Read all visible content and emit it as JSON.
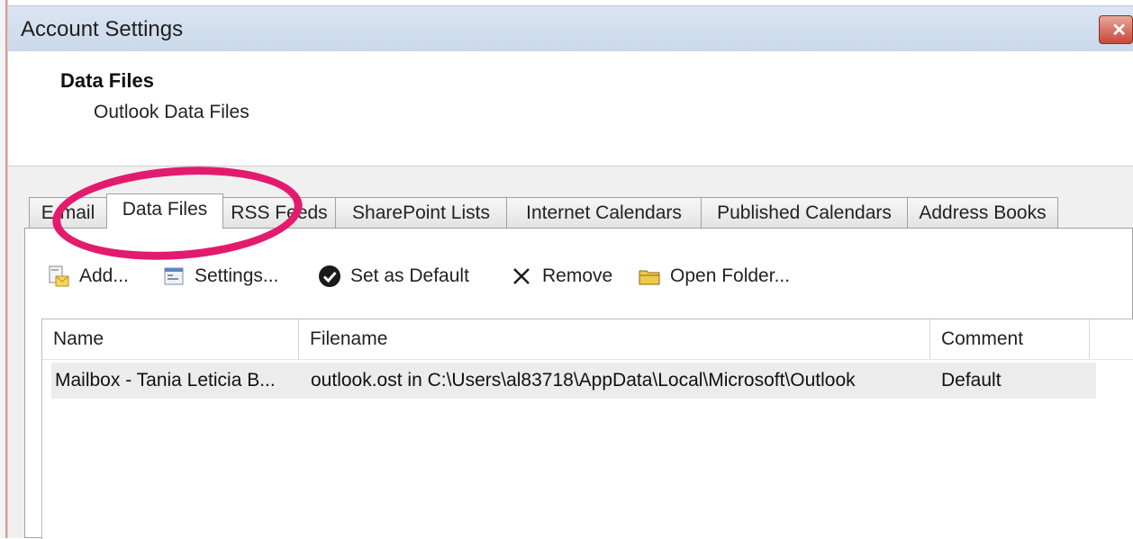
{
  "window": {
    "title": "Account Settings",
    "close_label": "✕"
  },
  "header": {
    "title": "Data Files",
    "subtitle": "Outlook Data Files"
  },
  "tabs": [
    {
      "label": "E-mail"
    },
    {
      "label": "Data Files"
    },
    {
      "label": "RSS Feeds"
    },
    {
      "label": "SharePoint Lists"
    },
    {
      "label": "Internet Calendars"
    },
    {
      "label": "Published Calendars"
    },
    {
      "label": "Address Books"
    }
  ],
  "toolbar": {
    "add": {
      "label": "Add...",
      "icon": "add-data-file-icon"
    },
    "settings": {
      "label": "Settings...",
      "icon": "settings-icon"
    },
    "set_default": {
      "label": "Set as Default",
      "icon": "checkmark-icon"
    },
    "remove": {
      "label": "Remove",
      "icon": "remove-x-icon"
    },
    "open_folder": {
      "label": "Open Folder...",
      "icon": "folder-icon"
    }
  },
  "table": {
    "columns": [
      "Name",
      "Filename",
      "Comment"
    ],
    "rows": [
      {
        "name": "Mailbox - Tania Leticia B...",
        "filename": "outlook.ost in C:\\Users\\al83718\\AppData\\Local\\Microsoft\\Outlook",
        "comment": "Default"
      }
    ]
  },
  "annotation": {
    "color": "#e21b6e"
  }
}
